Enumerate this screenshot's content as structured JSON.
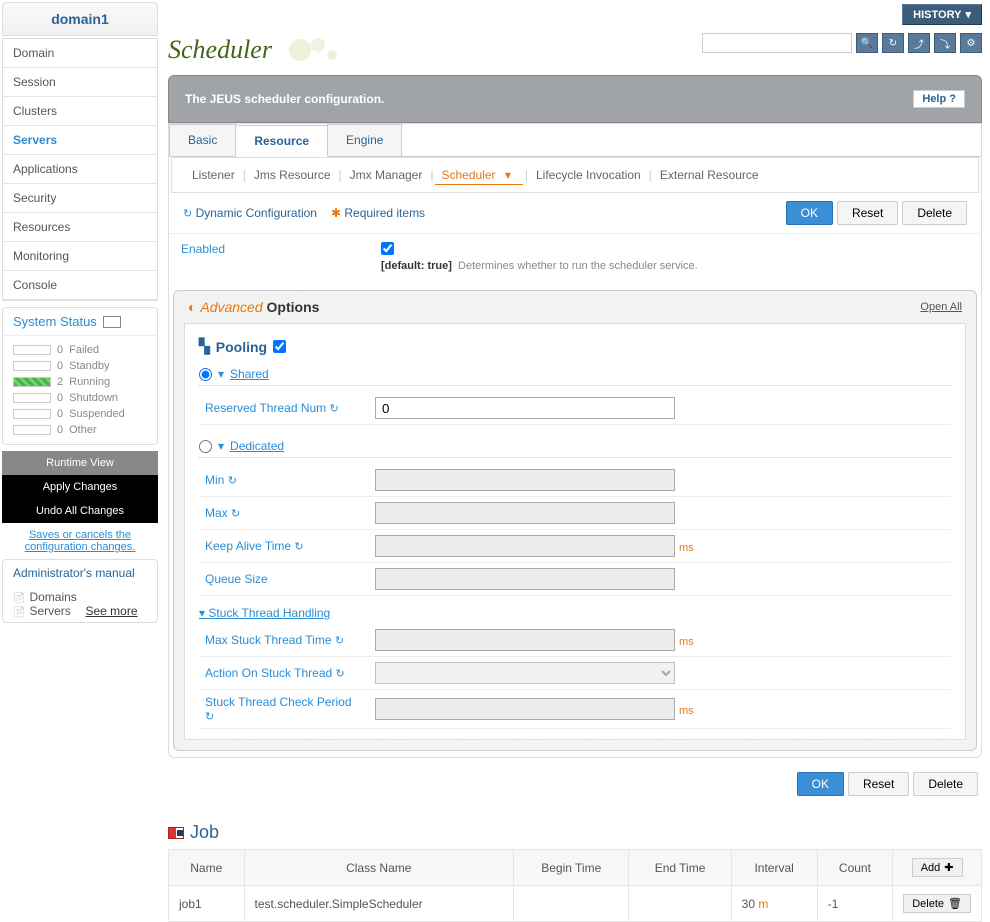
{
  "sidebar": {
    "title": "domain1",
    "items": [
      "Domain",
      "Session",
      "Clusters",
      "Servers",
      "Applications",
      "Security",
      "Resources",
      "Monitoring",
      "Console"
    ],
    "active_index": 3,
    "system_status_title": "System Status",
    "statuses": [
      {
        "count": "0",
        "label": "Failed",
        "running": false
      },
      {
        "count": "0",
        "label": "Standby",
        "running": false
      },
      {
        "count": "2",
        "label": "Running",
        "running": true
      },
      {
        "count": "0",
        "label": "Shutdown",
        "running": false
      },
      {
        "count": "0",
        "label": "Suspended",
        "running": false
      },
      {
        "count": "0",
        "label": "Other",
        "running": false
      }
    ],
    "btn_runtime": "Runtime View",
    "btn_apply": "Apply Changes",
    "btn_undo": "Undo All Changes",
    "saves_link": "Saves or cancels the configuration changes.",
    "admin_manual": "Administrator's manual",
    "admin_items": [
      "Domains",
      "Servers"
    ],
    "see_more": "See more"
  },
  "topbar": {
    "history": "HISTORY"
  },
  "page": {
    "title": "Scheduler"
  },
  "desc": {
    "text": "The JEUS scheduler configuration.",
    "help": "Help"
  },
  "tabs": {
    "items": [
      "Basic",
      "Resource",
      "Engine"
    ],
    "active": 1
  },
  "subtabs": {
    "items": [
      "Listener",
      "Jms Resource",
      "Jmx Manager",
      "Scheduler",
      "Lifecycle Invocation",
      "External Resource"
    ],
    "active": 3
  },
  "config_bar": {
    "dynamic": "Dynamic Configuration",
    "required": "Required items",
    "ok": "OK",
    "reset": "Reset",
    "delete": "Delete"
  },
  "enabled": {
    "label": "Enabled",
    "default_prefix": "[default:",
    "default_val": "true",
    "default_suffix": "]",
    "note": "Determines whether to run the scheduler service."
  },
  "advanced": {
    "adv_label": "Advanced",
    "options_label": "Options",
    "open_all": "Open All",
    "pooling": "Pooling",
    "shared": "Shared",
    "reserved": "Reserved Thread Num",
    "reserved_val": "0",
    "dedicated": "Dedicated",
    "min": "Min",
    "max": "Max",
    "keep": "Keep Alive Time",
    "queue": "Queue Size",
    "stuck_head": "Stuck Thread Handling",
    "max_stuck": "Max Stuck Thread Time",
    "action_stuck": "Action On Stuck Thread",
    "check_period": "Stuck Thread Check Period",
    "ms": "ms"
  },
  "job": {
    "title": "Job",
    "headers": [
      "Name",
      "Class Name",
      "Begin Time",
      "End Time",
      "Interval",
      "Count"
    ],
    "add": "Add",
    "delete": "Delete",
    "rows": [
      {
        "name": "job1",
        "class": "test.scheduler.SimpleScheduler",
        "begin": "",
        "end": "",
        "interval_val": "30",
        "interval_unit": "m",
        "count": "-1"
      }
    ]
  }
}
